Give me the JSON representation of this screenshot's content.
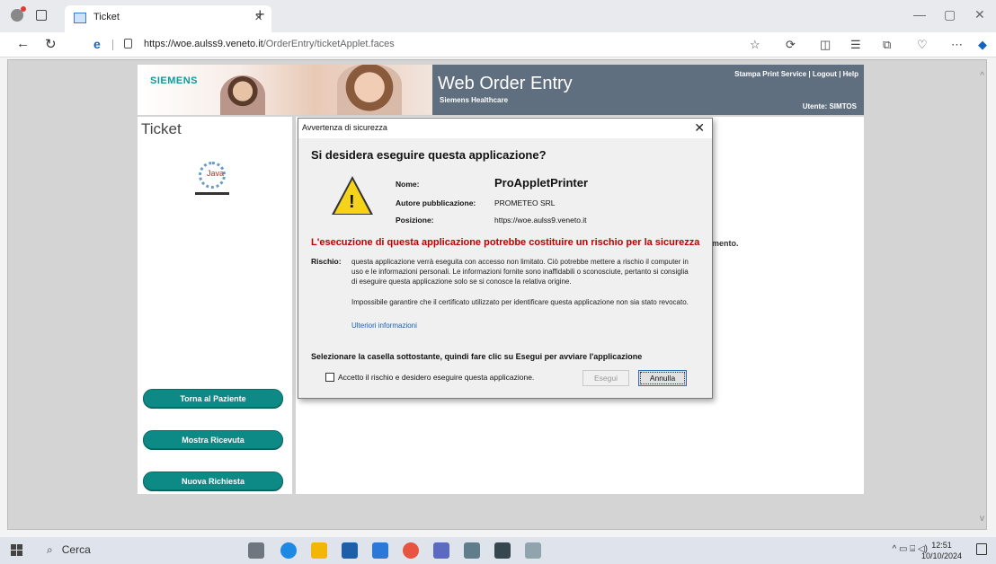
{
  "browser": {
    "tab_title": "Ticket",
    "tab_close": "×",
    "new_tab": "+",
    "url_host": "https://woe.aulss9.veneto.it",
    "url_path": "/OrderEntry/ticketApplet.faces",
    "win_min": "—",
    "win_restore": "▢",
    "win_close": "✕"
  },
  "header": {
    "brand": "SIEMENS",
    "title": "Web Order Entry",
    "subtitle": "Siemens Healthcare",
    "links": "Stampa Print Service | Logout | Help",
    "user": "Utente: SIMTOS"
  },
  "left": {
    "title": "Ticket",
    "java_label": "Java",
    "buttons": [
      "Torna al Paziente",
      "Mostra Ricevuta",
      "Nuova Richiesta"
    ]
  },
  "main": {
    "behind_text": "mento."
  },
  "dialog": {
    "title": "Avvertenza di sicurezza",
    "close": "✕",
    "heading": "Si desidera eseguire questa applicazione?",
    "name_label": "Nome:",
    "name_value": "ProAppletPrinter",
    "publisher_label": "Autore pubblicazione:",
    "publisher_value": "PROMETEO SRL",
    "location_label": "Posizione:",
    "location_value": "https://woe.aulss9.veneto.it",
    "risk_heading": "L'esecuzione di questa applicazione potrebbe costituire un rischio per la sicurezza",
    "risk_label": "Rischio:",
    "risk_text": "questa applicazione verrà eseguita con accesso non limitato. Ciò potrebbe mettere a rischio il computer in uso e le informazioni personali. Le informazioni fornite sono inaffidabili o sconosciute, pertanto si consiglia di eseguire questa applicazione solo se si conosce la relativa origine.",
    "cert_text": "Impossibile garantire che il certificato utilizzato per identificare questa applicazione non sia stato revocato.",
    "more_info": "Ulteriori informazioni",
    "instruction": "Selezionare la casella sottostante, quindi fare clic su Esegui per avviare l'applicazione",
    "checkbox_label": "Accetto il rischio e desidero eseguire questa applicazione.",
    "run_button": "Esegui",
    "cancel_button": "Annulla"
  },
  "taskbar": {
    "search": "Cerca",
    "time": "12:51",
    "date": "10/10/2024"
  }
}
